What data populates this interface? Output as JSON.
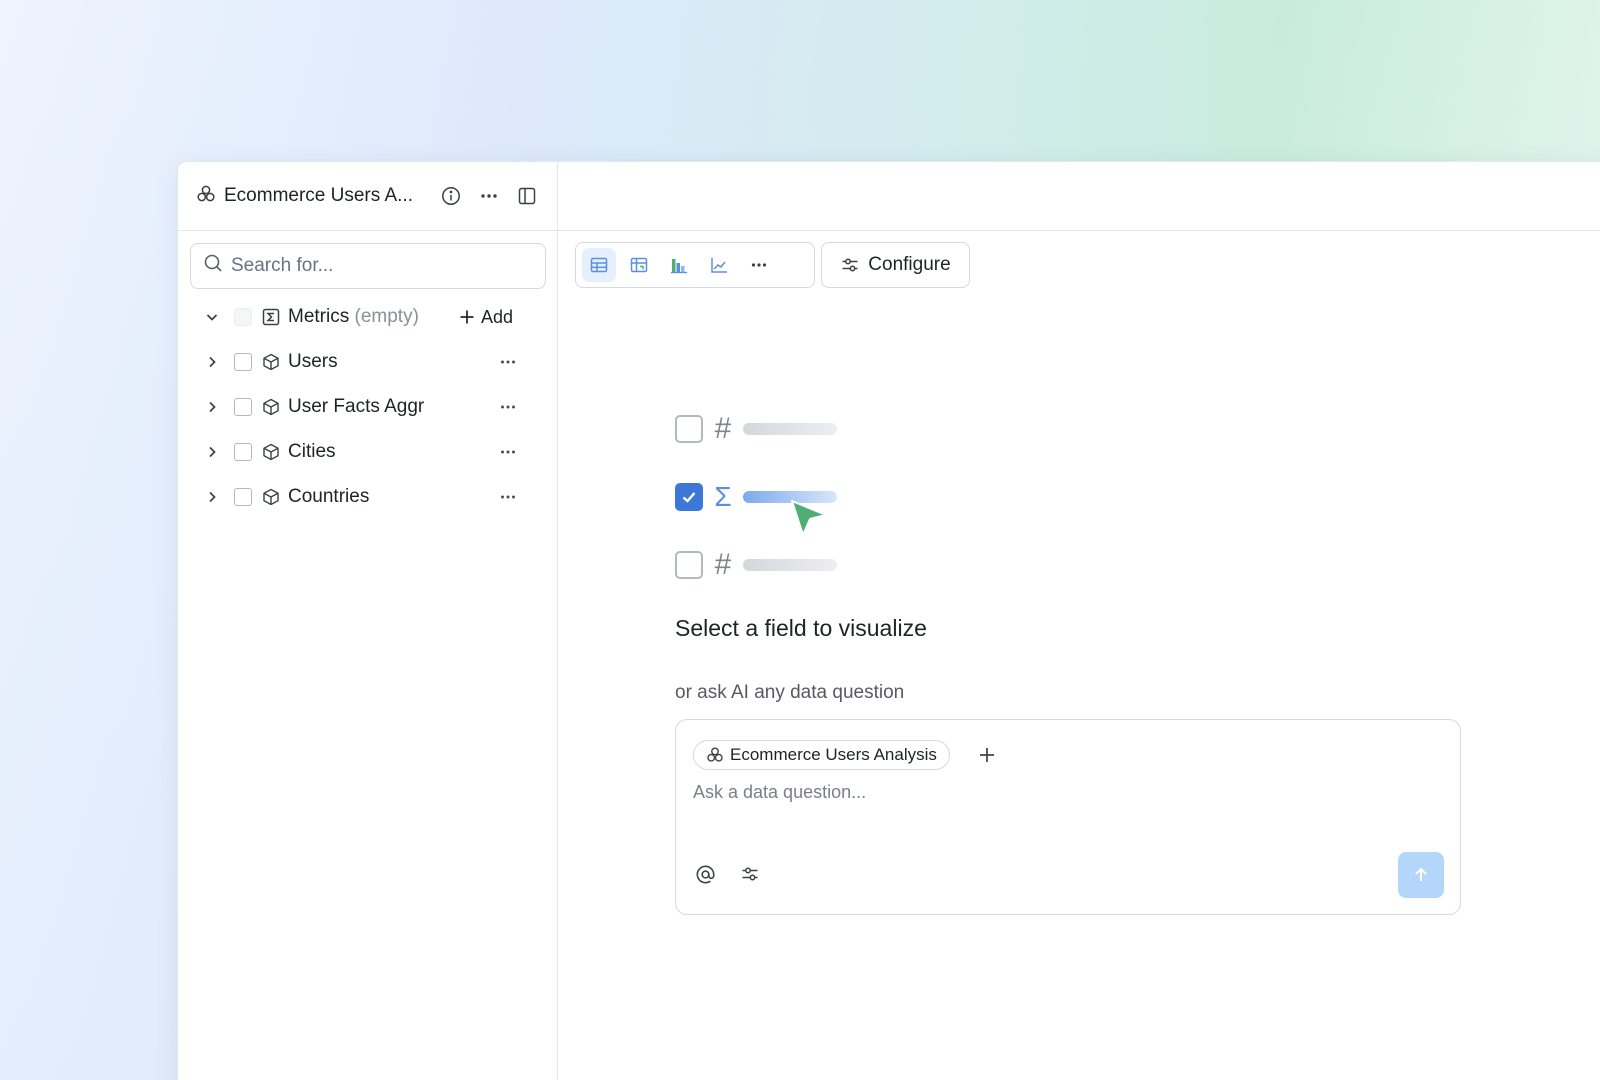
{
  "sidebar": {
    "title": "Ecommerce Users A...",
    "search_placeholder": "Search for...",
    "metrics": {
      "label": "Metrics",
      "status": "(empty)",
      "add_label": "Add"
    },
    "entities": [
      {
        "label": "Users"
      },
      {
        "label": "User Facts Aggr"
      },
      {
        "label": "Cities"
      },
      {
        "label": "Countries"
      }
    ]
  },
  "toolbar": {
    "visualizations": [
      {
        "icon": "table-icon",
        "active": true
      },
      {
        "icon": "pivot-table-icon",
        "active": false
      },
      {
        "icon": "bar-chart-icon",
        "active": false
      },
      {
        "icon": "line-chart-icon",
        "active": false
      },
      {
        "icon": "more-horizontal-icon",
        "active": false
      }
    ],
    "configure_label": "Configure"
  },
  "empty_state": {
    "headline": "Select a field to visualize",
    "ask_caption": "or ask AI any data question",
    "chip_label": "Ecommerce Users Analysis",
    "ask_placeholder": "Ask a data question..."
  },
  "colors": {
    "accent": "#3d78d8",
    "send_button": "#b5d6fb",
    "cursor": "#4fae73"
  }
}
